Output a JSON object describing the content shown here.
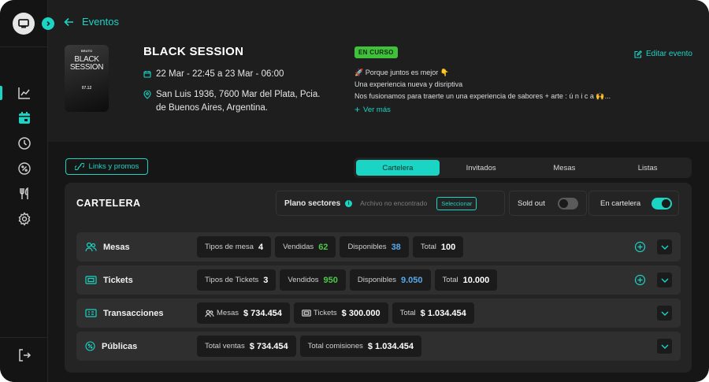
{
  "sidebar": {
    "items": [
      {
        "name": "chart-line-icon",
        "active": false
      },
      {
        "name": "calendar-icon",
        "active": true
      },
      {
        "name": "clock-icon",
        "active": false
      },
      {
        "name": "discount-icon",
        "active": false
      },
      {
        "name": "utensils-icon",
        "active": false
      },
      {
        "name": "gear-icon",
        "active": false
      }
    ],
    "logout_icon": "logout-icon"
  },
  "header": {
    "back_label": "Eventos",
    "poster": {
      "brand": "BRUTO",
      "title_line1": "BLACK",
      "title_line2": "SESSION",
      "date": "07.12"
    },
    "event_title": "BLACK SESSION",
    "date_range": "22 Mar - 22:45 a 23 Mar - 06:00",
    "address": "San Luis 1936, 7600 Mar del Plata, Pcia. de Buenos Aires, Argentina.",
    "status_badge": "EN CURSO",
    "description": [
      "🚀 Porque juntos es mejor 👇",
      "Una experiencia nueva y disriptiva",
      "Nos fusionamos para traerte un una experiencia de sabores + arte : ú n i c a 🙌..."
    ],
    "see_more": "Ver más",
    "edit_label": "Editar evento"
  },
  "toolbar": {
    "links_label": "Links y promos",
    "tabs": [
      {
        "label": "Cartelera",
        "active": true
      },
      {
        "label": "Invitados",
        "active": false
      },
      {
        "label": "Mesas",
        "active": false
      },
      {
        "label": "Listas",
        "active": false
      }
    ]
  },
  "panel": {
    "title": "CARTELERA",
    "sectores_label": "Plano sectores",
    "file_status": "Archivo no encontrado",
    "select_label": "Seleccionar",
    "soldout_label": "Sold out",
    "soldout_on": false,
    "cartelera_label": "En cartelera",
    "cartelera_on": true,
    "rows": [
      {
        "label": "Mesas",
        "icon": "users-icon",
        "has_add": true,
        "chips": [
          {
            "label": "Tipos de mesa",
            "value": "4",
            "color": ""
          },
          {
            "label": "Vendidas",
            "value": "62",
            "color": "green"
          },
          {
            "label": "Disponibles",
            "value": "38",
            "color": "blue"
          },
          {
            "label": "Total",
            "value": "100",
            "color": ""
          }
        ]
      },
      {
        "label": "Tickets",
        "icon": "ticket-icon",
        "has_add": true,
        "chips": [
          {
            "label": "Tipos de Tickets",
            "value": "3",
            "color": ""
          },
          {
            "label": "Vendidos",
            "value": "950",
            "color": "green"
          },
          {
            "label": "Disponibles",
            "value": "9.050",
            "color": "blue"
          },
          {
            "label": "Total",
            "value": "10.000",
            "color": ""
          }
        ]
      },
      {
        "label": "Transacciones",
        "icon": "receipt-icon",
        "has_add": false,
        "chips": [
          {
            "label": "Mesas",
            "value": "$ 734.454",
            "color": "",
            "icon": "users-icon"
          },
          {
            "label": "Tickets",
            "value": "$ 300.000",
            "color": "",
            "icon": "ticket-icon"
          },
          {
            "label": "Total",
            "value": "$ 1.034.454",
            "color": ""
          }
        ]
      },
      {
        "label": "Públicas",
        "icon": "badge-percent-icon",
        "has_add": false,
        "chips": [
          {
            "label": "Total ventas",
            "value": "$ 734.454",
            "color": ""
          },
          {
            "label": "Total comisiones",
            "value": "$ 1.034.454",
            "color": ""
          }
        ]
      }
    ]
  },
  "colors": {
    "accent": "#1ad4c4",
    "status_green": "#3fc23a",
    "value_green": "#4cc748",
    "value_blue": "#57a9ec"
  }
}
